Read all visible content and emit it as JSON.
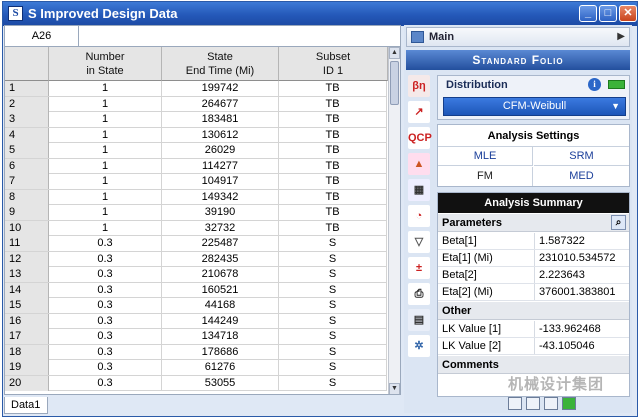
{
  "window": {
    "title": "S Improved Design Data",
    "icon": "S"
  },
  "grid": {
    "cell_ref": "A26",
    "headers": [
      [
        "Number",
        "in State"
      ],
      [
        "State",
        "End Time (Mi)"
      ],
      [
        "Subset",
        "ID 1"
      ]
    ],
    "rows": [
      {
        "n": "1",
        "c1": "1",
        "c2": "199742",
        "c3": "TB"
      },
      {
        "n": "2",
        "c1": "1",
        "c2": "264677",
        "c3": "TB"
      },
      {
        "n": "3",
        "c1": "1",
        "c2": "183481",
        "c3": "TB"
      },
      {
        "n": "4",
        "c1": "1",
        "c2": "130612",
        "c3": "TB"
      },
      {
        "n": "5",
        "c1": "1",
        "c2": "26029",
        "c3": "TB"
      },
      {
        "n": "6",
        "c1": "1",
        "c2": "114277",
        "c3": "TB"
      },
      {
        "n": "7",
        "c1": "1",
        "c2": "104917",
        "c3": "TB"
      },
      {
        "n": "8",
        "c1": "1",
        "c2": "149342",
        "c3": "TB"
      },
      {
        "n": "9",
        "c1": "1",
        "c2": "39190",
        "c3": "TB"
      },
      {
        "n": "10",
        "c1": "1",
        "c2": "32732",
        "c3": "TB"
      },
      {
        "n": "11",
        "c1": "0.3",
        "c2": "225487",
        "c3": "S"
      },
      {
        "n": "12",
        "c1": "0.3",
        "c2": "282435",
        "c3": "S"
      },
      {
        "n": "13",
        "c1": "0.3",
        "c2": "210678",
        "c3": "S"
      },
      {
        "n": "14",
        "c1": "0.3",
        "c2": "160521",
        "c3": "S"
      },
      {
        "n": "15",
        "c1": "0.3",
        "c2": "44168",
        "c3": "S"
      },
      {
        "n": "16",
        "c1": "0.3",
        "c2": "144249",
        "c3": "S"
      },
      {
        "n": "17",
        "c1": "0.3",
        "c2": "134718",
        "c3": "S"
      },
      {
        "n": "18",
        "c1": "0.3",
        "c2": "178686",
        "c3": "S"
      },
      {
        "n": "19",
        "c1": "0.3",
        "c2": "61276",
        "c3": "S"
      },
      {
        "n": "20",
        "c1": "0.3",
        "c2": "53055",
        "c3": "S"
      }
    ],
    "sheet_tab": "Data1"
  },
  "side": {
    "main_label": "Main",
    "folio_title": "Standard Folio",
    "distribution": {
      "title": "Distribution",
      "selected": "CFM-Weibull"
    },
    "analysis_settings": {
      "title": "Analysis Settings",
      "options": [
        "MLE",
        "SRM",
        "FM",
        "MED"
      ]
    },
    "analysis_summary": {
      "title": "Analysis Summary",
      "parameters_title": "Parameters",
      "parameters": [
        {
          "k": "Beta[1]",
          "v": "1.587322"
        },
        {
          "k": "Eta[1] (Mi)",
          "v": "231010.534572"
        },
        {
          "k": "Beta[2]",
          "v": "2.223643"
        },
        {
          "k": "Eta[2] (Mi)",
          "v": "376001.383801"
        }
      ],
      "other_title": "Other",
      "other": [
        {
          "k": "LK Value [1]",
          "v": "-133.962468"
        },
        {
          "k": "LK Value [2]",
          "v": "-43.105046"
        }
      ],
      "comments_title": "Comments"
    },
    "tools": [
      "beta-icon",
      "probability-plot-icon",
      "qcp-icon",
      "warning-icon",
      "table-icon",
      "gauge-icon",
      "filter-icon",
      "calc-icon",
      "print-icon",
      "report-icon",
      "settings-icon"
    ]
  },
  "colors": {
    "titlebar": "#2458b8",
    "folio": "#2f61b4",
    "select": "#1d56b8",
    "summary_header": "#111111"
  },
  "watermark": "机械设计集团"
}
